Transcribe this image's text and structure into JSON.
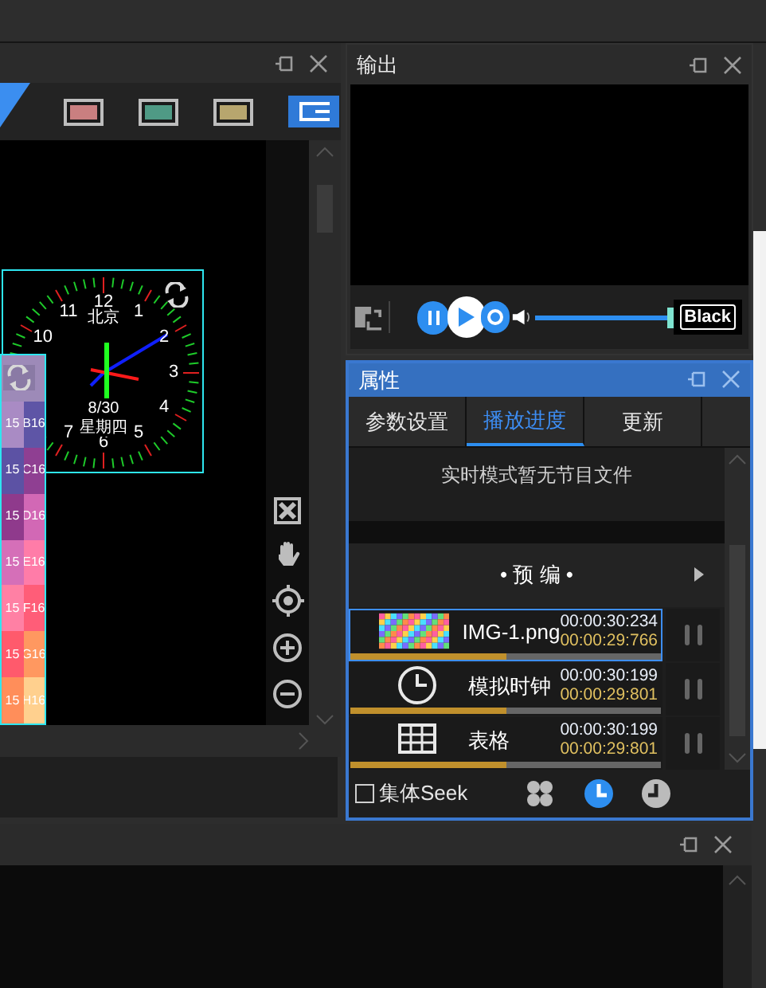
{
  "canvas_panel": {
    "swatches": [
      {
        "color": "#c97f80"
      },
      {
        "color": "#4f9a85"
      },
      {
        "color": "#b7a66e"
      }
    ],
    "clock": {
      "numerals": [
        "12",
        "1",
        "2",
        "3",
        "4",
        "5",
        "6",
        "7",
        "10",
        "11"
      ],
      "city": "北京",
      "date": "8/30",
      "weekday": "星期四"
    },
    "table_cells": [
      {
        "text": "15",
        "color": "#a98bc4"
      },
      {
        "text": "B16",
        "color": "#5e55a6"
      },
      {
        "text": "15",
        "color": "#5c52a4"
      },
      {
        "text": "C16",
        "color": "#8f3f92"
      },
      {
        "text": "15",
        "color": "#8f3a8c"
      },
      {
        "text": "D16",
        "color": "#d268b5"
      },
      {
        "text": "15",
        "color": "#d56fb8"
      },
      {
        "text": "E16",
        "color": "#ff7ca8"
      },
      {
        "text": "15",
        "color": "#ff80a4"
      },
      {
        "text": "F16",
        "color": "#ff5d78"
      },
      {
        "text": "15",
        "color": "#ff5a6c"
      },
      {
        "text": "G16",
        "color": "#ff9860"
      },
      {
        "text": "15",
        "color": "#ff8e5a"
      },
      {
        "text": "H16",
        "color": "#ffd08e"
      }
    ]
  },
  "output_panel": {
    "title": "输出",
    "volume": {
      "level": 1
    },
    "black_button": "Black"
  },
  "properties_panel": {
    "title": "属性",
    "tabs": [
      {
        "label": "参数设置",
        "selected": false
      },
      {
        "label": "播放进度",
        "selected": true
      },
      {
        "label": "更新",
        "selected": false
      }
    ],
    "notice": "实时模式暂无节目文件",
    "section": "• 预 编 •",
    "items": [
      {
        "name": "IMG-1.png",
        "time_elapsed": "00:00:30:234",
        "time_remaining": "00:00:29:766",
        "level": 0.5,
        "selected": true
      },
      {
        "kind": "clock",
        "name": "模拟时钟",
        "time_elapsed": "00:00:30:199",
        "time_remaining": "00:00:29:801",
        "level": 0.5,
        "selected": false
      },
      {
        "kind": "table",
        "name": "表格",
        "time_elapsed": "00:00:30:199",
        "time_remaining": "00:00:29:801",
        "level": 0.5,
        "selected": false
      }
    ],
    "collective_seek": {
      "label": "集体Seek",
      "checked": false
    }
  }
}
